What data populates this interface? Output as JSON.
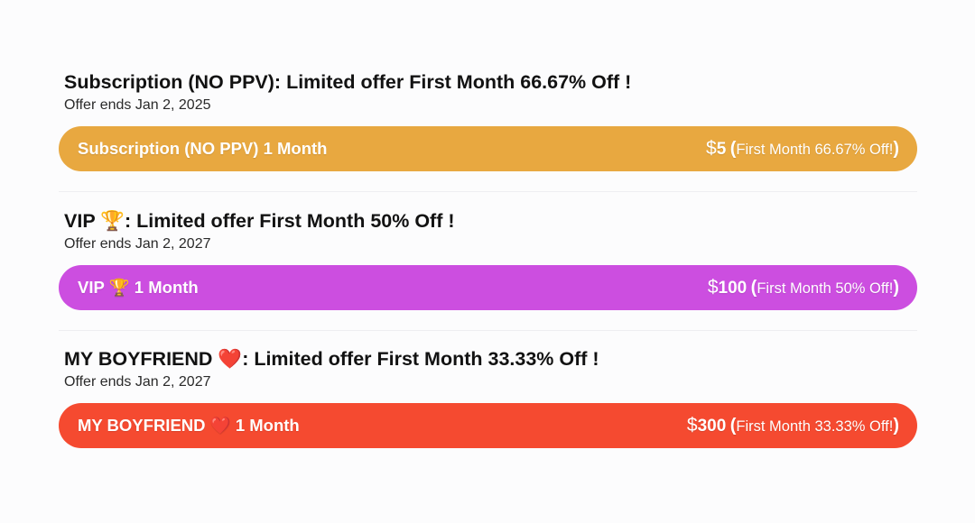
{
  "offers": [
    {
      "title": "Subscription (NO PPV): Limited offer First Month 66.67% Off !",
      "ends": "Offer ends Jan 2, 2025",
      "plan_label": "Subscription (NO PPV) 1 Month",
      "currency": "$",
      "price": "5",
      "paren_open": "(",
      "discount": "First Month 66.67% Off!",
      "paren_close": ")",
      "color": "#e8a840"
    },
    {
      "title": "VIP 🏆: Limited offer First Month 50% Off !",
      "ends": "Offer ends Jan 2, 2027",
      "plan_label": "VIP 🏆 1 Month",
      "currency": "$",
      "price": "100",
      "paren_open": "(",
      "discount": "First Month 50% Off!",
      "paren_close": ")",
      "color": "#cc4ee0"
    },
    {
      "title": "MY BOYFRIEND ❤️: Limited offer First Month 33.33% Off !",
      "ends": "Offer ends Jan 2, 2027",
      "plan_label": "MY BOYFRIEND ❤️ 1 Month",
      "currency": "$",
      "price": "300",
      "paren_open": "(",
      "discount": "First Month 33.33% Off!",
      "paren_close": ")",
      "color": "#f54a30"
    }
  ]
}
